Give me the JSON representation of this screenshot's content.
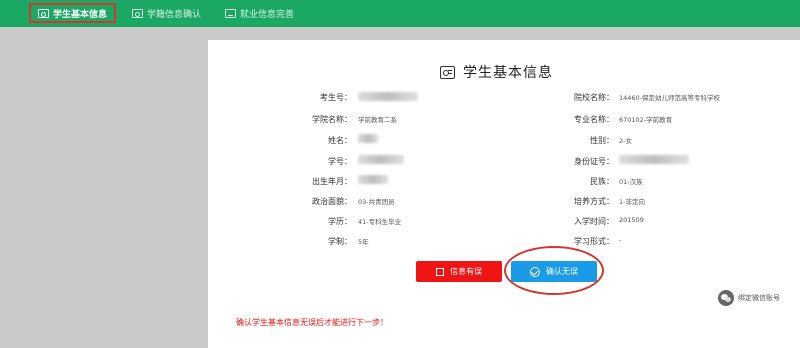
{
  "nav": {
    "tabs": [
      {
        "label": "学生基本信息",
        "icon": "id-card-icon",
        "active": true
      },
      {
        "label": "学籍信息确认",
        "icon": "id-card-icon",
        "active": false
      },
      {
        "label": "就业信息完善",
        "icon": "monitor-icon",
        "active": false
      }
    ]
  },
  "card": {
    "title": "学生基本信息",
    "left": [
      {
        "label": "考生号：",
        "value": ""
      },
      {
        "label": "学院名称：",
        "value": "学前教育二系"
      },
      {
        "label": "姓名：",
        "value": ""
      },
      {
        "label": "学号：",
        "value": ""
      },
      {
        "label": "出生年月：",
        "value": ""
      },
      {
        "label": "政治面貌：",
        "value": "03-共青团员"
      },
      {
        "label": "学历：",
        "value": "41-专科生毕业"
      },
      {
        "label": "学制：",
        "value": "5年"
      }
    ],
    "right": [
      {
        "label": "院校名称：",
        "value": "14460-保定幼儿师范高等专科学校"
      },
      {
        "label": "专业名称：",
        "value": "670102-学前教育"
      },
      {
        "label": "性别：",
        "value": "2-女"
      },
      {
        "label": "身份证号：",
        "value": ""
      },
      {
        "label": "民族：",
        "value": "01-汉族"
      },
      {
        "label": "培养方式：",
        "value": "1-非定向"
      },
      {
        "label": "入学时间：",
        "value": "201509"
      },
      {
        "label": "学习形式：",
        "value": "-"
      }
    ],
    "buttons": {
      "error": "信息有误",
      "confirm": "确认无误"
    },
    "wechat": "绑定微信账号",
    "warning": "确认学生基本信息无误后才能进行下一步！"
  },
  "colors": {
    "nav_bg": "#1aa864",
    "error_btn": "#ef1515",
    "confirm_btn": "#1a9be8",
    "annotation": "#d9342b"
  }
}
